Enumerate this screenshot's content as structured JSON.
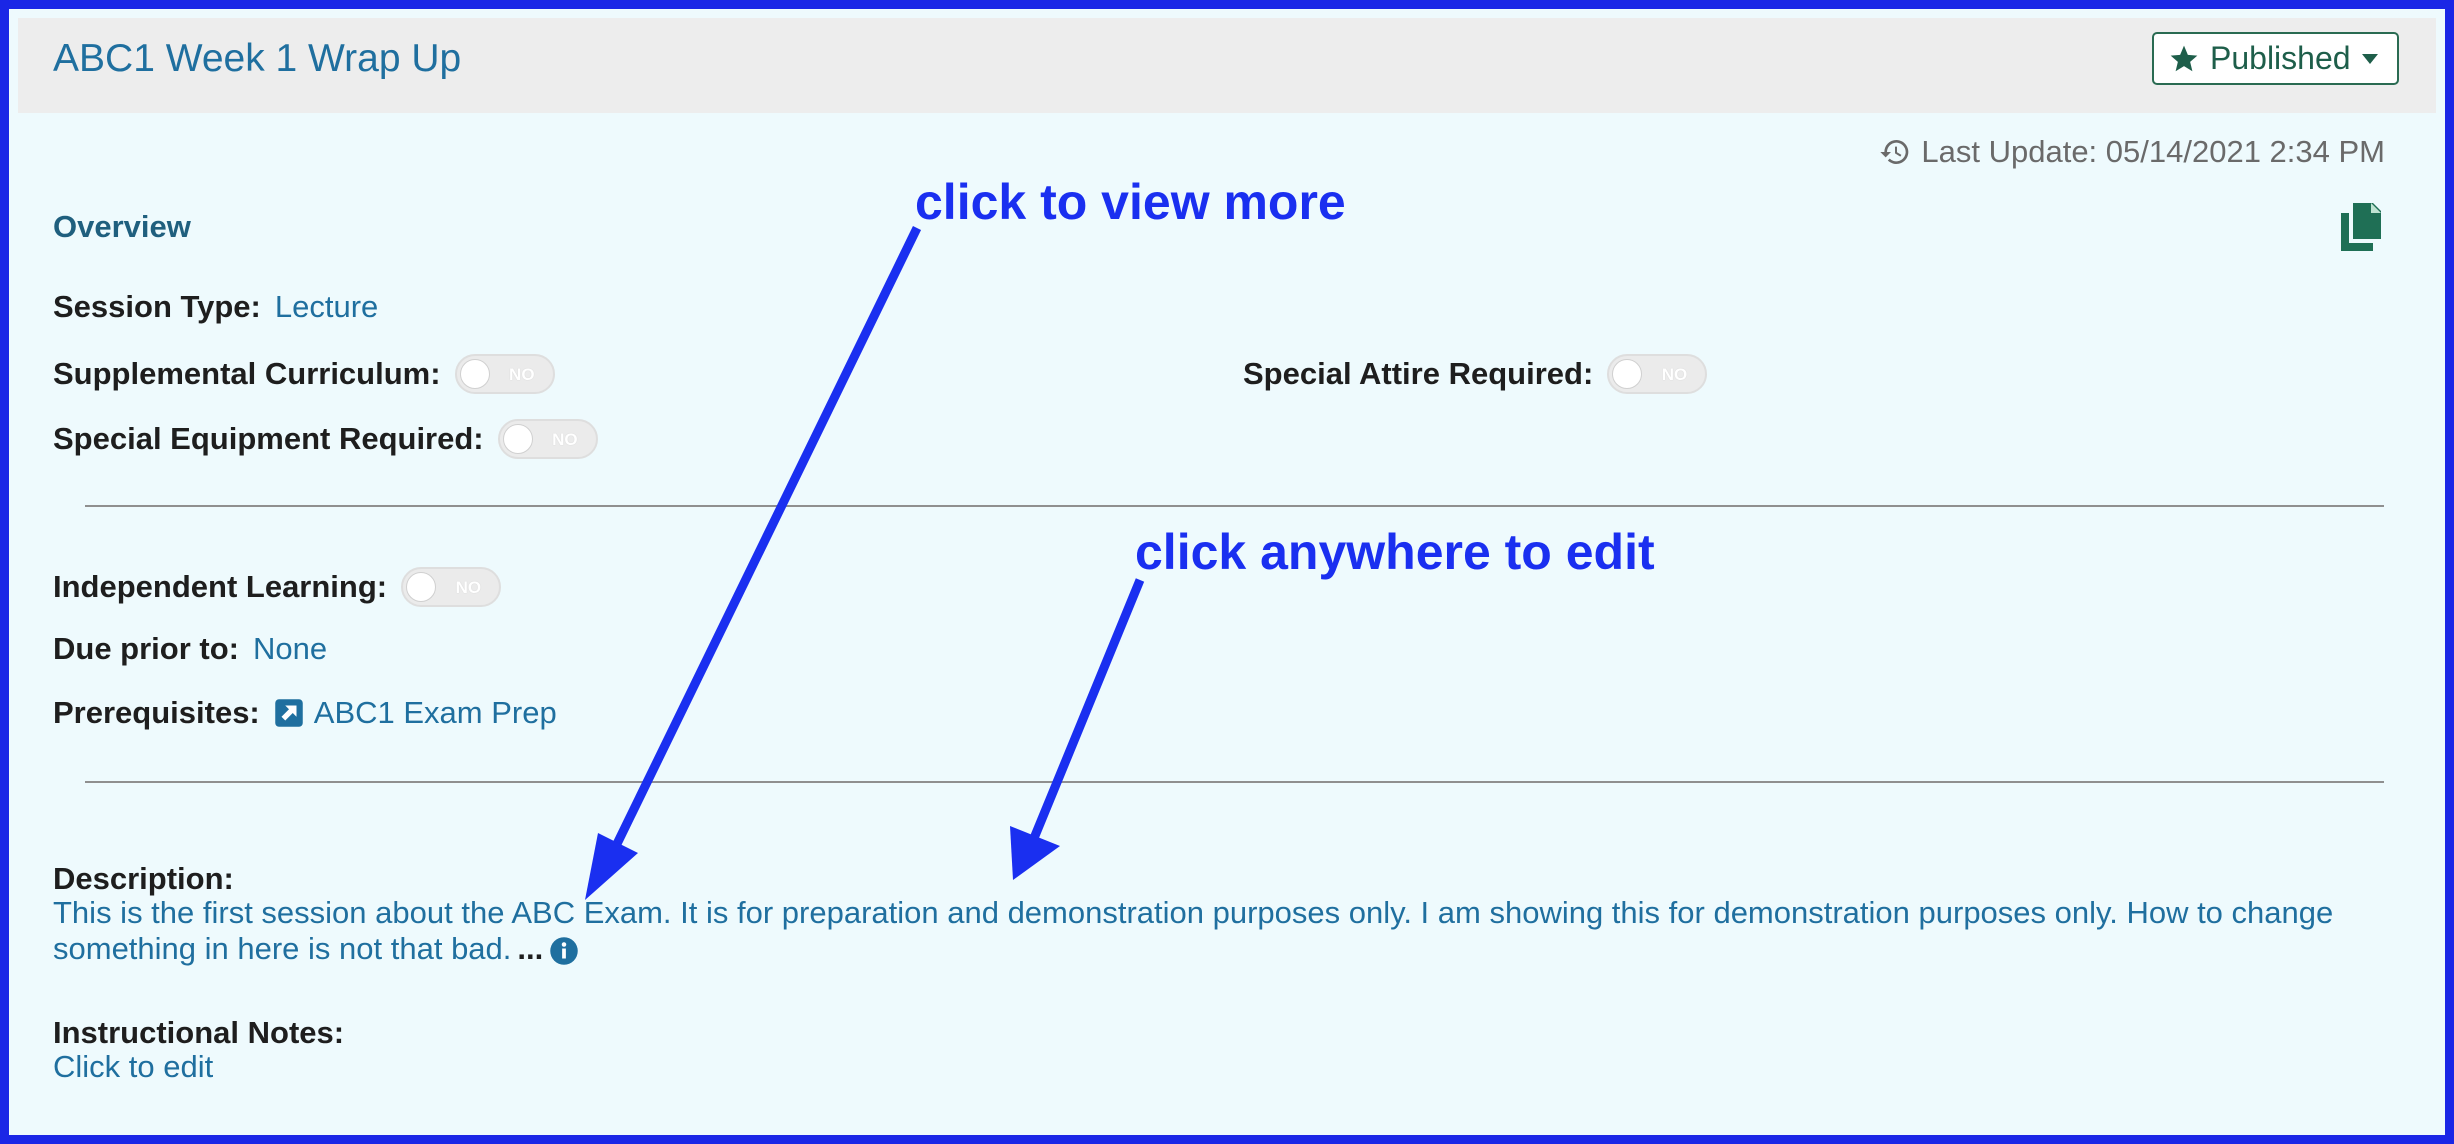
{
  "header": {
    "title": "ABC1 Week 1 Wrap Up",
    "status_button": {
      "label": "Published",
      "icon": "star-icon",
      "caret_icon": "caret-down-icon",
      "color": "#2a6b52"
    }
  },
  "last_update": {
    "icon": "history-icon",
    "text": "Last Update: 05/14/2021 2:34 PM"
  },
  "overview": {
    "heading": "Overview",
    "copy_icon": "copy-icon",
    "session_type": {
      "label": "Session Type:",
      "value": "Lecture"
    },
    "supplemental_curriculum": {
      "label": "Supplemental Curriculum:",
      "toggle": "NO"
    },
    "special_attire_required": {
      "label": "Special Attire Required:",
      "toggle": "NO"
    },
    "special_equipment_required": {
      "label": "Special Equipment Required:",
      "toggle": "NO"
    },
    "independent_learning": {
      "label": "Independent Learning:",
      "toggle": "NO"
    },
    "due_prior_to": {
      "label": "Due prior to:",
      "value": "None"
    },
    "prerequisites": {
      "label": "Prerequisites:",
      "icon": "external-link-icon",
      "value": "ABC1 Exam Prep"
    }
  },
  "description": {
    "label": "Description:",
    "text": "This is the first session about the ABC Exam. It is for preparation and demonstration purposes only. I am showing this for demonstration purposes only. How to change something in here is not that bad.",
    "ellipsis": "...",
    "info_icon": "info-icon"
  },
  "instructional_notes": {
    "label": "Instructional Notes:",
    "value": "Click to edit"
  },
  "annotations": {
    "view_more": "click to view more",
    "edit_anywhere": "click anywhere to edit",
    "color": "#1a2ff0"
  },
  "colors": {
    "frame": "#1a26e6",
    "background": "#eefafd",
    "link": "#1f6f9f",
    "header_bg": "#ededed"
  }
}
